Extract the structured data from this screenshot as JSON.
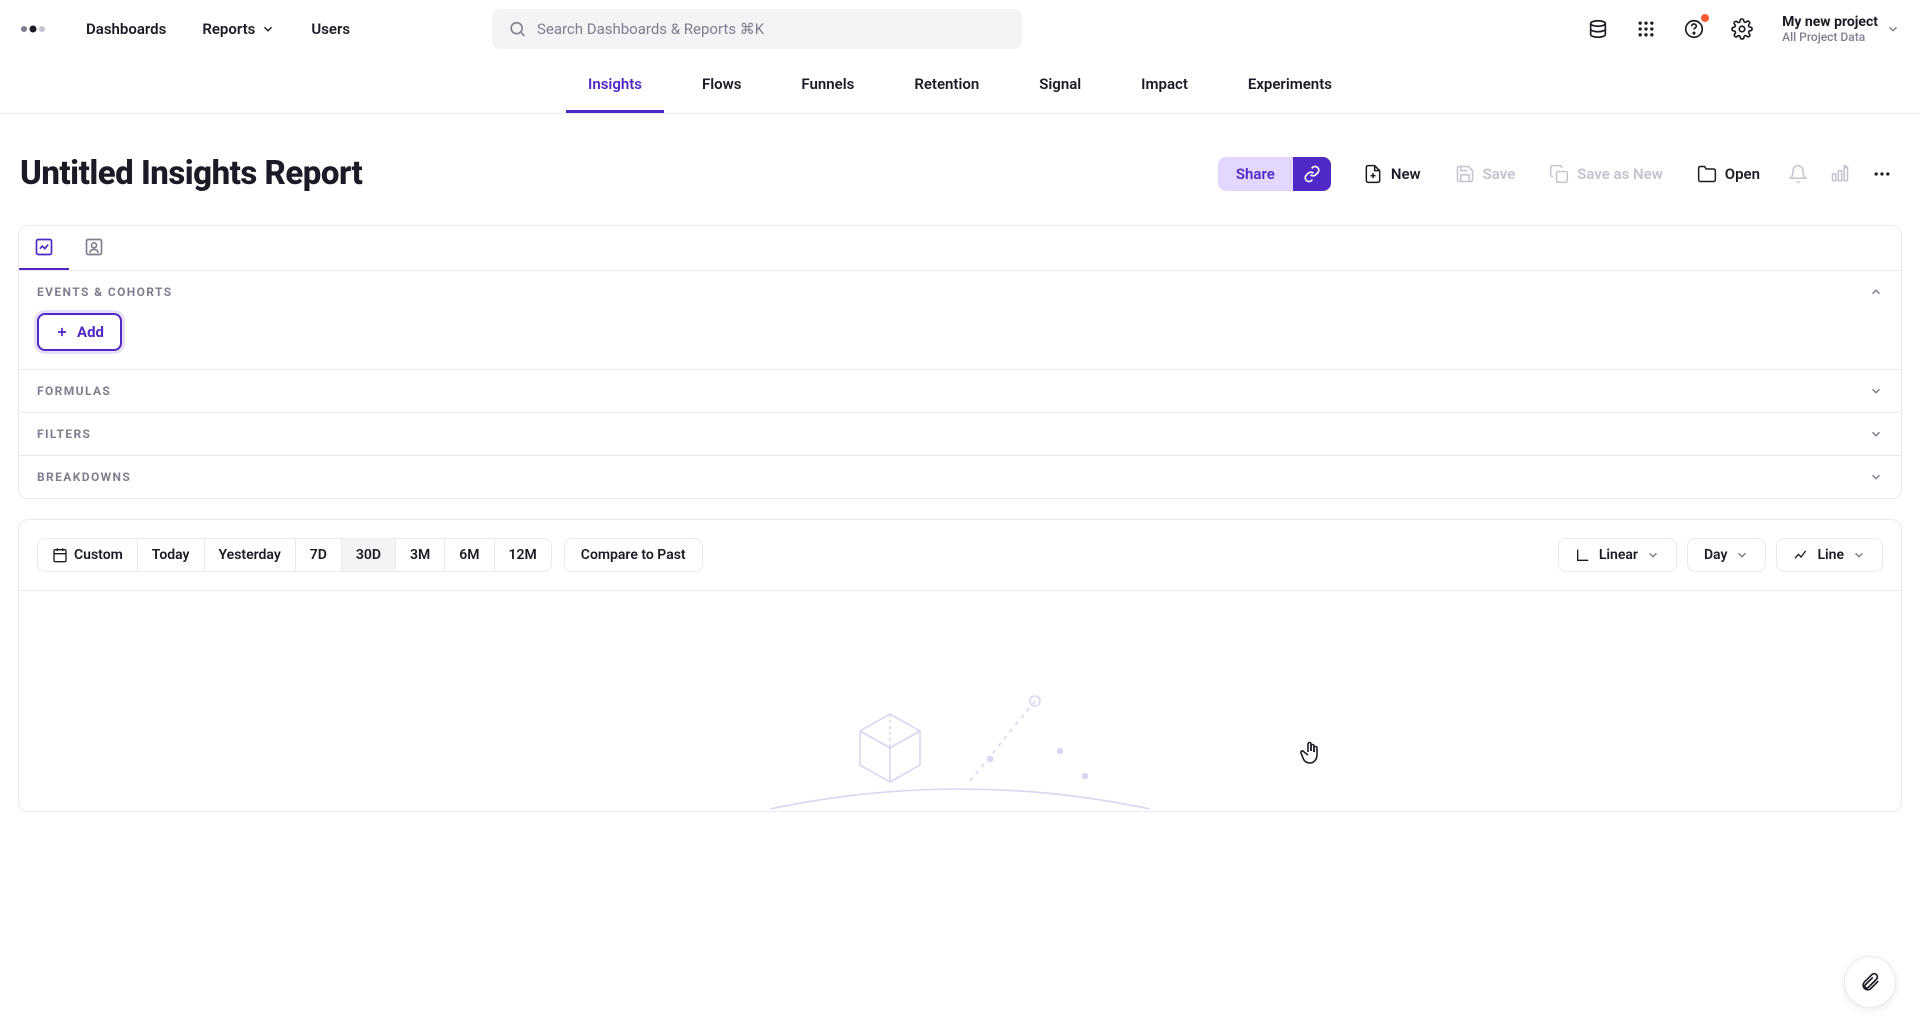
{
  "header": {
    "nav": {
      "dashboards": "Dashboards",
      "reports": "Reports",
      "users": "Users"
    },
    "search_placeholder": "Search Dashboards & Reports ⌘K",
    "project": {
      "name": "My new project",
      "sub": "All Project Data"
    }
  },
  "subtabs": {
    "insights": "Insights",
    "flows": "Flows",
    "funnels": "Funnels",
    "retention": "Retention",
    "signal": "Signal",
    "impact": "Impact",
    "experiments": "Experiments"
  },
  "report": {
    "title": "Untitled Insights Report",
    "actions": {
      "share": "Share",
      "new": "New",
      "save": "Save",
      "save_as_new": "Save as New",
      "open": "Open"
    }
  },
  "builder": {
    "events_cohorts": "Events & Cohorts",
    "add": "Add",
    "formulas": "Formulas",
    "filters": "Filters",
    "breakdowns": "Breakdowns"
  },
  "chart_toolbar": {
    "ranges": {
      "custom": "Custom",
      "today": "Today",
      "yesterday": "Yesterday",
      "d7": "7D",
      "d30": "30D",
      "m3": "3M",
      "m6": "6M",
      "m12": "12M"
    },
    "compare": "Compare to Past",
    "scale": "Linear",
    "granularity": "Day",
    "chart_type": "Line"
  }
}
